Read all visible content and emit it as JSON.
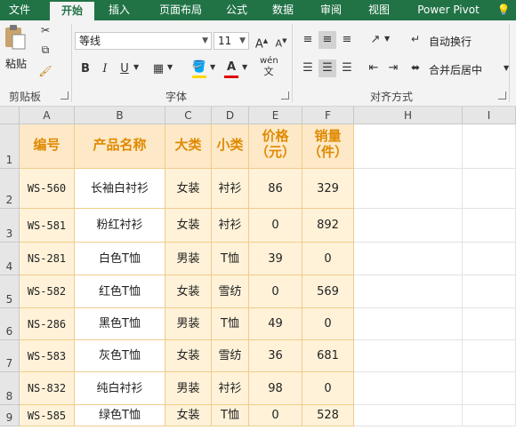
{
  "tabs": [
    "文件",
    "开始",
    "插入",
    "页面布局",
    "公式",
    "数据",
    "审阅",
    "视图",
    "Power Pivot"
  ],
  "active_tab": "开始",
  "colors": {
    "accent": "#217346",
    "header_fill": "#fde9c8",
    "header_text": "#e08a00",
    "band_fill": "#fff2d9",
    "border": "#f0cc8a"
  },
  "ribbon": {
    "clipboard": {
      "paste_label": "粘贴",
      "group_label": "剪贴板"
    },
    "font": {
      "font_name": "等线",
      "font_size": "11",
      "bold": "B",
      "italic": "I",
      "underline": "U",
      "phonetic": "wén",
      "group_label": "字体"
    },
    "alignment": {
      "wrap_text": "自动换行",
      "merge_center": "合并后居中",
      "group_label": "对齐方式"
    }
  },
  "columns": [
    "A",
    "B",
    "C",
    "D",
    "E",
    "F",
    "H",
    "I"
  ],
  "rows": [
    "1",
    "2",
    "3",
    "4",
    "5",
    "6",
    "7",
    "8",
    "9"
  ],
  "table": {
    "headers": [
      "编号",
      "产品名称",
      "大类",
      "小类",
      "价格\n（元）",
      "销量\n（件）"
    ],
    "records": [
      [
        "WS-560",
        "长袖白衬衫",
        "女装",
        "衬衫",
        "86",
        "329"
      ],
      [
        "WS-581",
        "粉红衬衫",
        "女装",
        "衬衫",
        "0",
        "892"
      ],
      [
        "NS-281",
        "白色T恤",
        "男装",
        "T恤",
        "39",
        "0"
      ],
      [
        "WS-582",
        "红色T恤",
        "女装",
        "雪纺",
        "0",
        "569"
      ],
      [
        "NS-286",
        "黑色T恤",
        "男装",
        "T恤",
        "49",
        "0"
      ],
      [
        "WS-583",
        "灰色T恤",
        "女装",
        "雪纺",
        "36",
        "681"
      ],
      [
        "NS-832",
        "纯白衬衫",
        "男装",
        "衬衫",
        "98",
        "0"
      ],
      [
        "WS-585",
        "绿色T恤",
        "女装",
        "T恤",
        "0",
        "528"
      ]
    ]
  }
}
